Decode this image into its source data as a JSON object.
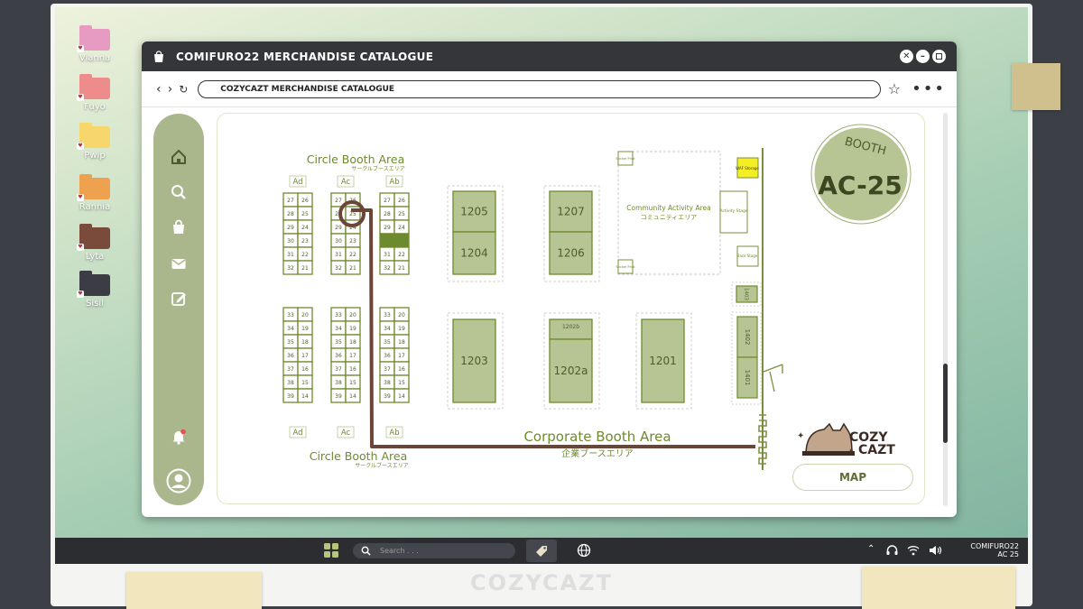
{
  "desktop": {
    "icons": [
      {
        "label": "Vianna",
        "color": "#e89bc2"
      },
      {
        "label": "Fuyo",
        "color": "#ee8b8b"
      },
      {
        "label": "Pwip",
        "color": "#f7d66b"
      },
      {
        "label": "Rannia",
        "color": "#eea24f"
      },
      {
        "label": "Lyta",
        "color": "#7a4b3a"
      },
      {
        "label": "Sisil",
        "color": "#3b3c44"
      }
    ],
    "brand": "COZYCAZT"
  },
  "window": {
    "title": "COMIFURO22 MERCHANDISE CATALOGUE",
    "url": "COZYCAZT MERCHANDISE CATALOGUE"
  },
  "sidenav": {
    "items": [
      "home-icon",
      "search-icon",
      "bag-icon",
      "mail-icon",
      "edit-icon",
      "bell-icon",
      "user-icon"
    ]
  },
  "map": {
    "circle_area_top": "Circle Booth Area",
    "circle_area_top_jp": "サークルブースエリア",
    "circle_area_bottom": "Circle Booth Area",
    "circle_area_bottom_jp": "サークルブースエリア",
    "corporate_area": "Corporate Booth Area",
    "corporate_area_jp": "企業ブースエリア",
    "community_area": "Community Activity Area",
    "community_area_jp": "コミュニティエリア",
    "activity_stage": "Activity Stage",
    "back_stage": "Back Stage",
    "sticker_print": "Sticker Print",
    "waf_storage": "WAF Storage",
    "row_labels_top": [
      "Ad",
      "Ac",
      "Ab"
    ],
    "row_labels_bottom": [
      "Ad",
      "Ac",
      "Ab"
    ],
    "circle_upper_rows": [
      [
        "27",
        "26"
      ],
      [
        "28",
        "25"
      ],
      [
        "29",
        "24"
      ],
      [
        "30",
        "23"
      ],
      [
        "31",
        "22"
      ],
      [
        "32",
        "21"
      ]
    ],
    "circle_lower_rows": [
      [
        "33",
        "20"
      ],
      [
        "34",
        "19"
      ],
      [
        "35",
        "18"
      ],
      [
        "36",
        "17"
      ],
      [
        "37",
        "16"
      ],
      [
        "38",
        "15"
      ],
      [
        "39",
        "14"
      ]
    ],
    "corporate_booths": [
      "1205",
      "1204",
      "1207",
      "1206",
      "1203",
      "1202b",
      "1202a",
      "1201"
    ],
    "side_booths": [
      "1403",
      "1402",
      "1401"
    ],
    "booth_badge_top": "BOOTH",
    "booth_badge_code": "AC-25",
    "logo_top": "COZY",
    "logo_bottom": "CAZT",
    "map_button": "MAP",
    "highlighted_booth": "25"
  },
  "taskbar": {
    "search_placeholder": "Search . . .",
    "clock_line1": "COMIFURO22",
    "clock_line2": "AC 25"
  },
  "colors": {
    "accent": "#6e8a2e",
    "booth_fill": "#b7c493",
    "route": "#6b4538",
    "window_bar": "#34363a"
  }
}
